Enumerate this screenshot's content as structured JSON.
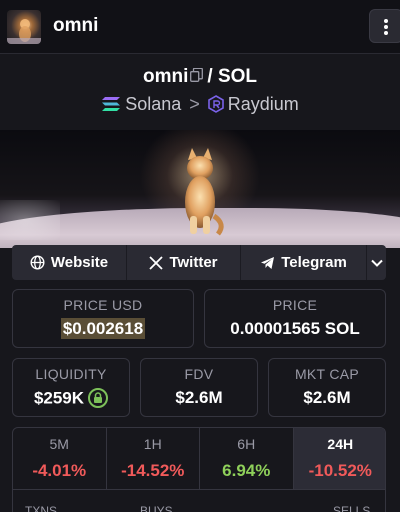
{
  "header": {
    "token_name": "omni",
    "menu_icon": "vertical-dots-icon"
  },
  "pair": {
    "base": "omni",
    "separator": "/",
    "quote": "SOL",
    "chain": "Solana",
    "dex": "Raydium",
    "chevron": ">"
  },
  "links": {
    "website": "Website",
    "twitter": "Twitter",
    "telegram": "Telegram"
  },
  "stats": {
    "price_usd_label": "PRICE USD",
    "price_usd": "$0.002618",
    "price_label": "PRICE",
    "price_sol": "0.00001565 SOL",
    "liquidity_label": "LIQUIDITY",
    "liquidity": "$259K",
    "fdv_label": "FDV",
    "fdv": "$2.6M",
    "mktcap_label": "MKT CAP",
    "mktcap": "$2.6M"
  },
  "timeframes": [
    {
      "label": "5M",
      "change": "-4.01%",
      "trend": "negative"
    },
    {
      "label": "1H",
      "change": "-14.52%",
      "trend": "negative"
    },
    {
      "label": "6H",
      "change": "6.94%",
      "trend": "positive"
    },
    {
      "label": "24H",
      "change": "-10.52%",
      "trend": "negative",
      "active": true
    }
  ],
  "sub_headers": {
    "txns": "TXNS",
    "buys": "BUYS",
    "sells": "SELLS"
  },
  "colors": {
    "negative": "#f05a5a",
    "positive": "#8fd05a",
    "lock": "#7dc15a"
  }
}
